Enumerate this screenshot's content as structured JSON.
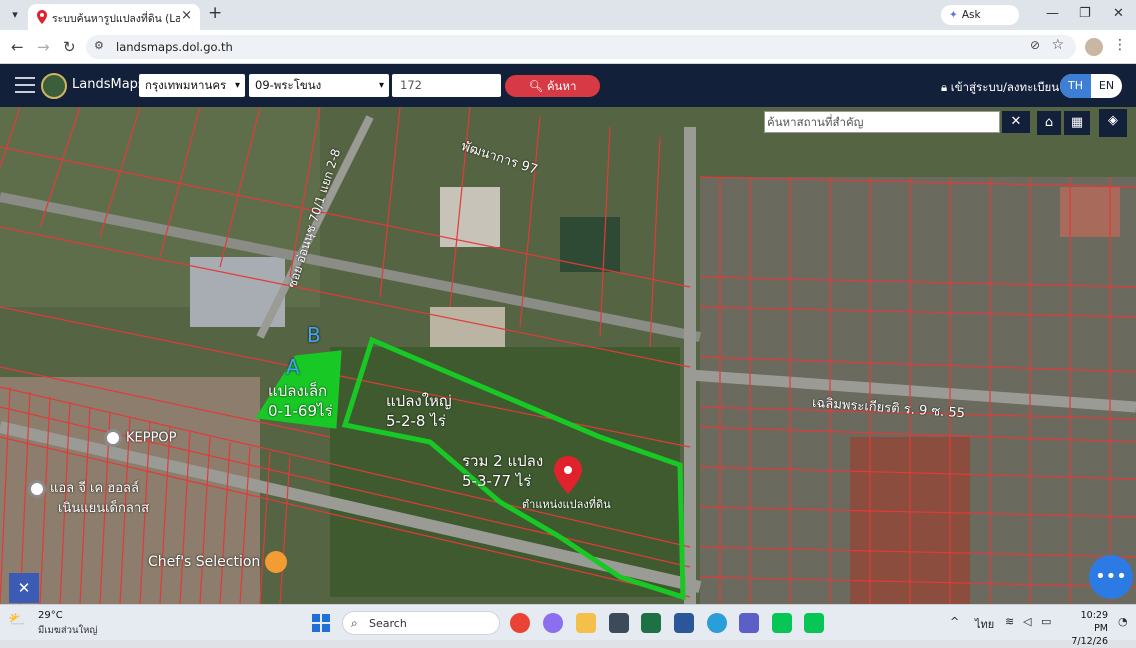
{
  "browser": {
    "tab_title": "ระบบค้นหารูปแปลงที่ดิน (LandsMaps)",
    "new_tab_icon": "+",
    "gemini_label": "Ask Gemini",
    "url": "landsmaps.dol.go.th"
  },
  "app": {
    "brand": "LandsMaps",
    "province_value": "กรุงเทพมหานคร",
    "district_value": "09-พระโขนง",
    "parcel_value": "172",
    "search_label": "ค้นหา",
    "login_label": "เข้าสู่ระบบ/ลงทะเบียน",
    "lang_th": "TH",
    "lang_en": "EN",
    "place_search_placeholder": "ค้นหาสถานที่สำคัญ",
    "place_clear": "✕"
  },
  "map": {
    "annotations": {
      "marker_a": "A",
      "marker_b": "B",
      "small_plot_title": "แปลงเล็ก",
      "small_plot_area": "0-1-69ไร่",
      "large_plot_title": "แปลงใหญ่",
      "large_plot_area": "5-2-8  ไร่",
      "total_title": "รวม 2 แปลง",
      "total_area": "5-3-77 ไร่",
      "pin_label": "ตำแหน่งแปลงที่ดิน"
    },
    "roads": {
      "road_1": "พัฒนาการ 97",
      "road_2": "ซอย อ่อนนุช 70/1 แยก 2-8",
      "road_3": "เฉลิมพระเกียรติ ร. 9 ซ. 55"
    },
    "pois": {
      "keppop": "KEPPOP",
      "chefs": "Chef's Selection",
      "market": "แอล จี เค ฮอลล์",
      "market_2": "เนินแยนเด็กลาส"
    },
    "colors": {
      "parcel_line": "#e23a3a",
      "highlight": "#18c926",
      "pin": "#e0222d"
    }
  },
  "taskbar": {
    "temp": "29°C",
    "weather_desc": "มีเมฆส่วนใหญ่",
    "search_label": "Search",
    "lang": "ไทย",
    "time": "10:29 PM",
    "date": "7/12/26"
  }
}
